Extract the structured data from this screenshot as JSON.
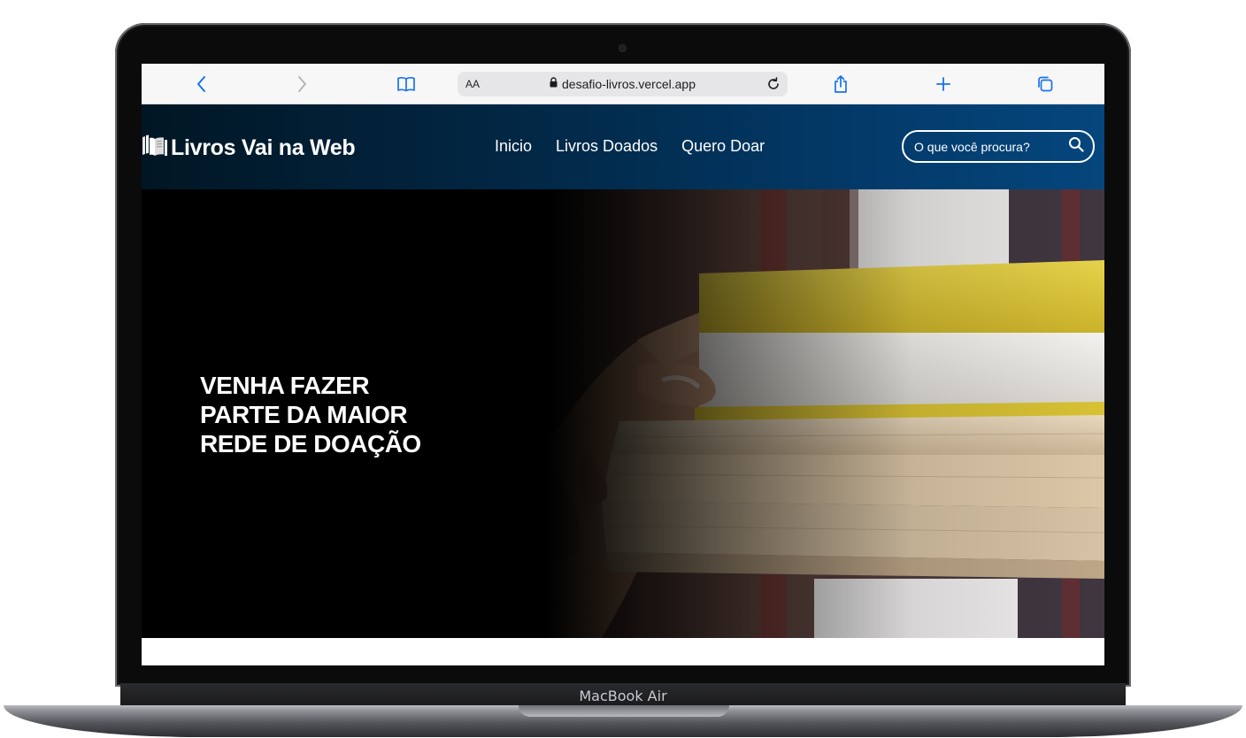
{
  "device": {
    "label": "MacBook Air"
  },
  "browser": {
    "text_size_label": "AA",
    "url": "desafio-livros.vercel.app",
    "icons": {
      "back": "chevron-left-icon",
      "forward": "chevron-right-icon",
      "bookmarks": "book-icon",
      "lock": "lock-icon",
      "reload": "reload-icon",
      "share": "share-icon",
      "new_tab": "plus-icon",
      "tabs": "tabs-icon"
    },
    "accent_color": "#1a73e8"
  },
  "site": {
    "logo_text": "Livros Vai na Web",
    "nav": [
      {
        "label": "Inicio"
      },
      {
        "label": "Livros Doados"
      },
      {
        "label": "Quero Doar"
      }
    ],
    "search": {
      "placeholder": "O que você procura?"
    },
    "header_colors": {
      "start": "#011624",
      "end": "#05467d"
    }
  },
  "hero": {
    "title_lines": [
      "VENHA FAZER",
      "PARTE DA MAIOR",
      "REDE DE DOAÇÃO"
    ]
  }
}
